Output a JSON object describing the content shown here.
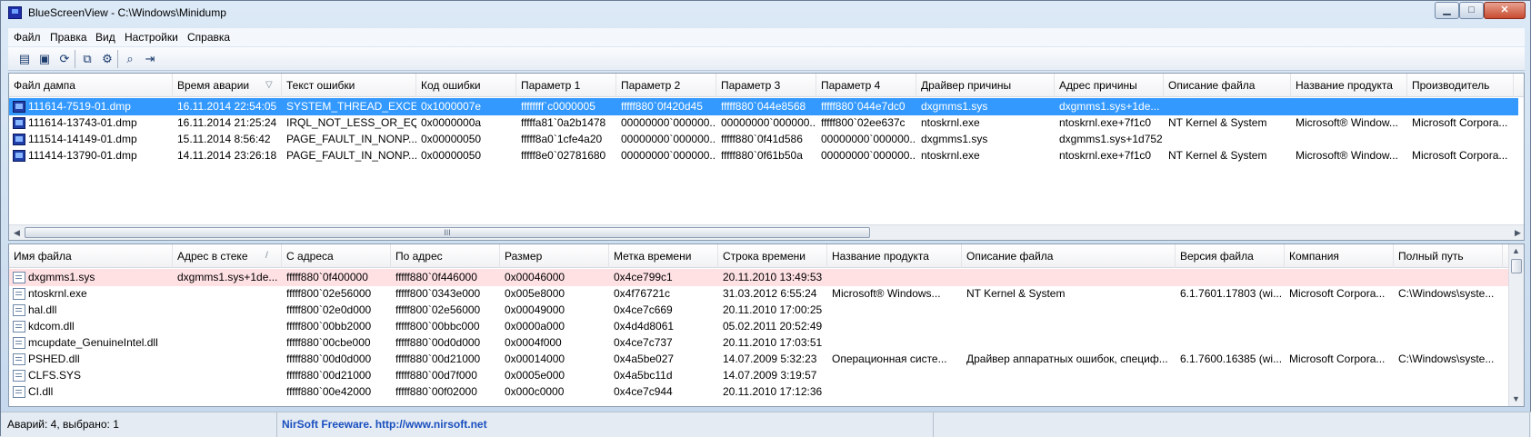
{
  "window": {
    "title": "BlueScreenView  -  C:\\Windows\\Minidump",
    "minimize": "▁",
    "maximize": "□",
    "close": "✕"
  },
  "menu": [
    "Файл",
    "Правка",
    "Вид",
    "Настройки",
    "Справка"
  ],
  "toolbar": [
    "properties-icon",
    "save-icon",
    "refresh-icon",
    "copy-icon",
    "options-icon",
    "find-icon",
    "exit-icon"
  ],
  "top_table": {
    "columns": [
      "Файл дампа",
      "Время аварии",
      "Текст ошибки",
      "Код ошибки",
      "Параметр 1",
      "Параметр 2",
      "Параметр 3",
      "Параметр 4",
      "Драйвер причины",
      "Адрес причины",
      "Описание файла",
      "Название продукта",
      "Производитель"
    ],
    "sort_indicator": "▽",
    "rows": [
      [
        "111614-7519-01.dmp",
        "16.11.2014 22:54:05",
        "SYSTEM_THREAD_EXCE...",
        "0x1000007e",
        "ffffffff`c0000005",
        "fffff880`0f420d45",
        "fffff880`044e8568",
        "fffff880`044e7dc0",
        "dxgmms1.sys",
        "dxgmms1.sys+1de...",
        "",
        "",
        ""
      ],
      [
        "111614-13743-01.dmp",
        "16.11.2014 21:25:24",
        "IRQL_NOT_LESS_OR_EQ...",
        "0x0000000a",
        "fffffa81`0a2b1478",
        "00000000`000000...",
        "00000000`000000...",
        "fffff800`02ee637c",
        "ntoskrnl.exe",
        "ntoskrnl.exe+7f1c0",
        "NT Kernel & System",
        "Microsoft® Window...",
        "Microsoft Corpora..."
      ],
      [
        "111514-14149-01.dmp",
        "15.11.2014 8:56:42",
        "PAGE_FAULT_IN_NONP...",
        "0x00000050",
        "fffff8a0`1cfe4a20",
        "00000000`000000...",
        "fffff880`0f41d586",
        "00000000`000000...",
        "dxgmms1.sys",
        "dxgmms1.sys+1d752",
        "",
        "",
        ""
      ],
      [
        "111414-13790-01.dmp",
        "14.11.2014 23:26:18",
        "PAGE_FAULT_IN_NONP...",
        "0x00000050",
        "fffff8e0`02781680",
        "00000000`000000...",
        "fffff880`0f61b50a",
        "00000000`000000...",
        "ntoskrnl.exe",
        "ntoskrnl.exe+7f1c0",
        "NT Kernel & System",
        "Microsoft® Window...",
        "Microsoft Corpora..."
      ]
    ],
    "scroll_grip": "III"
  },
  "bottom_table": {
    "columns": [
      "Имя файла",
      "Адрес в стеке",
      "С адреса",
      "По адрес",
      "Размер",
      "Метка времени",
      "Строка времени",
      "Название продукта",
      "Описание файла",
      "Версия файла",
      "Компания",
      "Полный путь"
    ],
    "sort_indicator": "/",
    "rows": [
      [
        "dxgmms1.sys",
        "dxgmms1.sys+1de...",
        "fffff880`0f400000",
        "fffff880`0f446000",
        "0x00046000",
        "0x4ce799c1",
        "20.11.2010 13:49:53",
        "",
        "",
        "",
        "",
        ""
      ],
      [
        "ntoskrnl.exe",
        "",
        "fffff800`02e56000",
        "fffff800`0343e000",
        "0x005e8000",
        "0x4f76721c",
        "31.03.2012 6:55:24",
        "Microsoft® Windows...",
        "NT Kernel & System",
        "6.1.7601.17803 (wi...",
        "Microsoft Corpora...",
        "C:\\Windows\\syste..."
      ],
      [
        "hal.dll",
        "",
        "fffff800`02e0d000",
        "fffff800`02e56000",
        "0x00049000",
        "0x4ce7c669",
        "20.11.2010 17:00:25",
        "",
        "",
        "",
        "",
        ""
      ],
      [
        "kdcom.dll",
        "",
        "fffff800`00bb2000",
        "fffff800`00bbc000",
        "0x0000a000",
        "0x4d4d8061",
        "05.02.2011 20:52:49",
        "",
        "",
        "",
        "",
        ""
      ],
      [
        "mcupdate_GenuineIntel.dll",
        "",
        "fffff880`00cbe000",
        "fffff880`00d0d000",
        "0x0004f000",
        "0x4ce7c737",
        "20.11.2010 17:03:51",
        "",
        "",
        "",
        "",
        ""
      ],
      [
        "PSHED.dll",
        "",
        "fffff880`00d0d000",
        "fffff880`00d21000",
        "0x00014000",
        "0x4a5be027",
        "14.07.2009 5:32:23",
        "Операционная систе...",
        "Драйвер аппаратных ошибок, специф...",
        "6.1.7600.16385 (wi...",
        "Microsoft Corpora...",
        "C:\\Windows\\syste..."
      ],
      [
        "CLFS.SYS",
        "",
        "fffff880`00d21000",
        "fffff880`00d7f000",
        "0x0005e000",
        "0x4a5bc11d",
        "14.07.2009 3:19:57",
        "",
        "",
        "",
        "",
        ""
      ],
      [
        "CI.dll",
        "",
        "fffff880`00e42000",
        "fffff880`00f02000",
        "0x000c0000",
        "0x4ce7c944",
        "20.11.2010 17:12:36",
        "",
        "",
        "",
        "",
        ""
      ]
    ]
  },
  "status": {
    "count": "Аварий: 4, выбрано: 1",
    "link": "NirSoft Freeware.  http://www.nirsoft.net"
  },
  "colors": {
    "selection": "#3399ff",
    "highlight_row": "#ffe1e4",
    "link": "#1a4fbf"
  }
}
